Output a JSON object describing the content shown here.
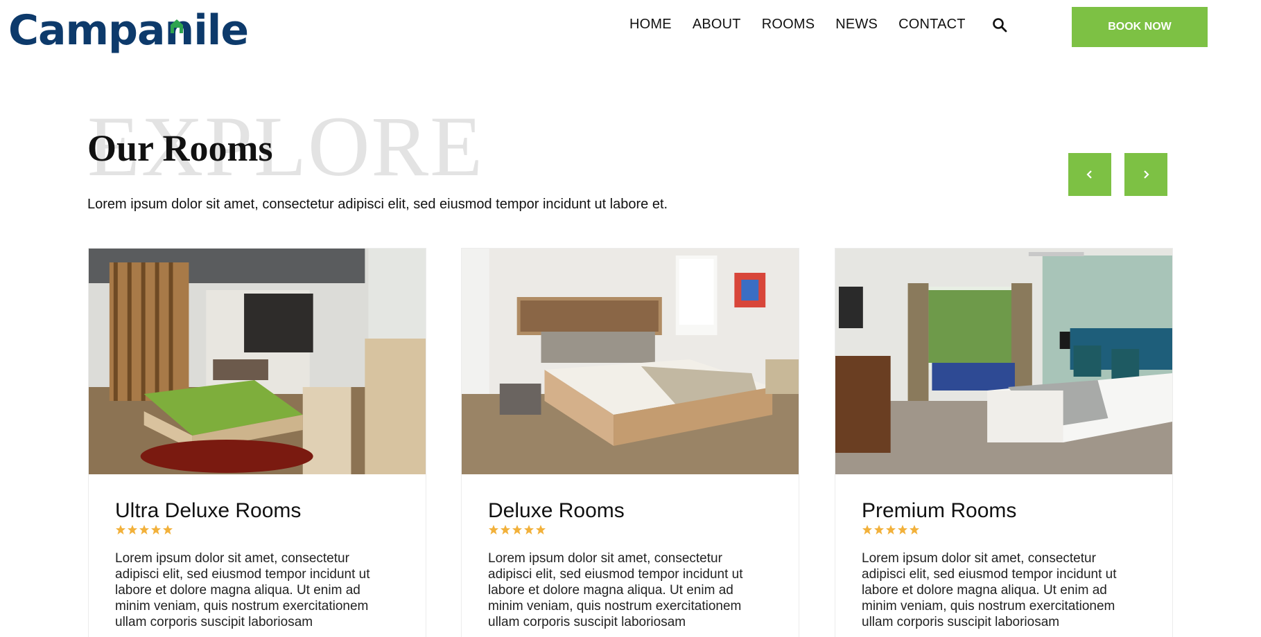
{
  "header": {
    "logo_text_part1": "Campa",
    "logo_text_n": "n",
    "logo_text_part2": "ile",
    "nav": [
      "HOME",
      "ABOUT",
      "ROOMS",
      "NEWS",
      "CONTACT"
    ],
    "search_icon": "search-icon",
    "book_label": "BOOK NOW",
    "accent_color": "#7dc144",
    "brand_color": "#0d3a6b"
  },
  "section": {
    "watermark": "EXPLORE",
    "title": "Our Rooms",
    "subtitle": "Lorem ipsum dolor sit amet, consectetur adipisci elit, sed eiusmod tempor incidunt ut labore et.",
    "prev_icon": "chevron-left-icon",
    "next_icon": "chevron-right-icon"
  },
  "rooms": [
    {
      "title": "Ultra Deluxe Rooms",
      "rating": 5,
      "description": "Lorem ipsum dolor sit amet, consectetur adipisci elit, sed eiusmod tempor incidunt ut labore et dolore magna aliqua. Ut enim ad minim veniam, quis nostrum exercitationem ullam corporis suscipit laboriosam"
    },
    {
      "title": "Deluxe Rooms",
      "rating": 5,
      "description": "Lorem ipsum dolor sit amet, consectetur adipisci elit, sed eiusmod tempor incidunt ut labore et dolore magna aliqua. Ut enim ad minim veniam, quis nostrum exercitationem ullam corporis suscipit laboriosam"
    },
    {
      "title": "Premium Rooms",
      "rating": 5,
      "description": "Lorem ipsum dolor sit amet, consectetur adipisci elit, sed eiusmod tempor incidunt ut labore et dolore magna aliqua. Ut enim ad minim veniam, quis nostrum exercitationem ullam corporis suscipit laboriosam"
    }
  ]
}
